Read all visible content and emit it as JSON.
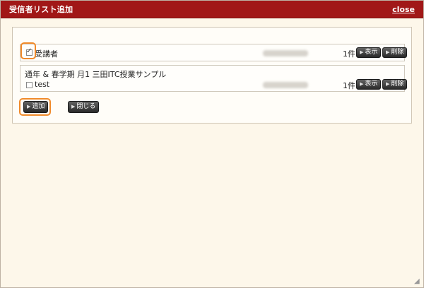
{
  "dialog": {
    "title": "受信者リスト追加",
    "close_label": "close"
  },
  "lists": [
    {
      "name": "受講者",
      "checked": true,
      "count": "1件",
      "show_label": "表示",
      "delete_label": "削除"
    },
    {
      "course": "通年 & 春学期 月1 三田ITC授業サンプル",
      "name": "test",
      "checked": false,
      "count": "1件",
      "show_label": "表示",
      "delete_label": "削除"
    }
  ],
  "actions": {
    "add_label": "追加",
    "close_label": "閉じる"
  }
}
